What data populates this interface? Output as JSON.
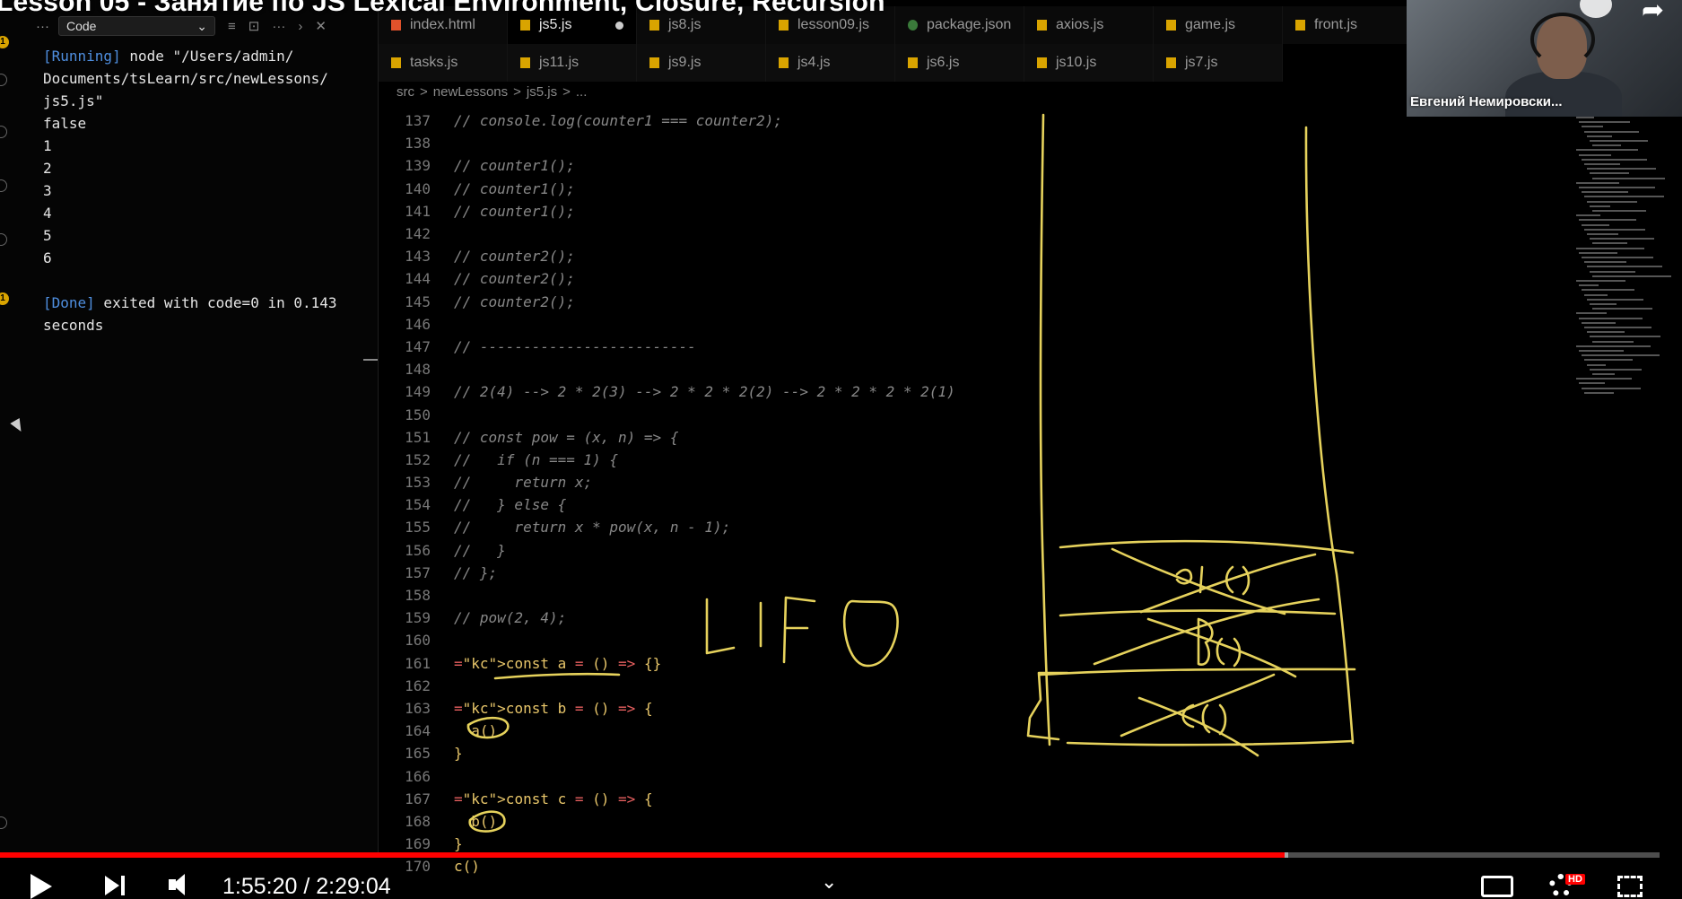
{
  "video": {
    "title": "Lesson 05 - Занятие по JS Lexical Environment, Closure, Recursion",
    "time_display": "1:55:20 / 2:29:04",
    "progress_fraction": 0.774,
    "buffered_fraction": 0.776,
    "hd_badge": "HD",
    "presenter_name": "Евгений Немировски..."
  },
  "output_panel": {
    "select_label": "Code",
    "lines": [
      {
        "prefix": "[Running]",
        "text": " node \"/Users/admin/"
      },
      {
        "prefix": "",
        "text": "Documents/tsLearn/src/newLessons/"
      },
      {
        "prefix": "",
        "text": "js5.js\""
      },
      {
        "prefix": "",
        "text": "false"
      },
      {
        "prefix": "",
        "text": "1"
      },
      {
        "prefix": "",
        "text": "2"
      },
      {
        "prefix": "",
        "text": "3"
      },
      {
        "prefix": "",
        "text": "4"
      },
      {
        "prefix": "",
        "text": "5"
      },
      {
        "prefix": "",
        "text": "6"
      },
      {
        "prefix": "",
        "text": ""
      },
      {
        "prefix": "[Done]",
        "text": " exited with code=0 in 0.143"
      },
      {
        "prefix": "",
        "text": "seconds"
      }
    ],
    "badge_count": "1"
  },
  "tabs_row1": [
    {
      "label": "index.html",
      "icon": "html-file-icon",
      "active": false
    },
    {
      "label": "js5.js",
      "icon": "js-file-icon",
      "active": true,
      "dirty": true
    },
    {
      "label": "js8.js",
      "icon": "js-file-icon",
      "active": false
    },
    {
      "label": "lesson09.js",
      "icon": "js-file-icon",
      "active": false
    },
    {
      "label": "package.json",
      "icon": "package-file-icon",
      "active": false
    },
    {
      "label": "axios.js",
      "icon": "js-file-icon",
      "active": false
    },
    {
      "label": "game.js",
      "icon": "js-file-icon",
      "active": false
    },
    {
      "label": "front.js",
      "icon": "js-file-icon",
      "active": false
    }
  ],
  "tabs_row2": [
    {
      "label": "tasks.js"
    },
    {
      "label": "js11.js"
    },
    {
      "label": "js9.js"
    },
    {
      "label": "js4.js"
    },
    {
      "label": "js6.js"
    },
    {
      "label": "js10.js"
    },
    {
      "label": "js7.js"
    }
  ],
  "breadcrumb": [
    "src",
    ">",
    "newLessons",
    ">",
    "js5.js",
    ">",
    "..."
  ],
  "code_lines": [
    {
      "n": "137",
      "t": "// console.log(counter1 === counter2);",
      "k": "c"
    },
    {
      "n": "138",
      "t": "",
      "k": "c"
    },
    {
      "n": "139",
      "t": "// counter1();",
      "k": "c"
    },
    {
      "n": "140",
      "t": "// counter1();",
      "k": "c"
    },
    {
      "n": "141",
      "t": "// counter1();",
      "k": "c"
    },
    {
      "n": "142",
      "t": "",
      "k": "c"
    },
    {
      "n": "143",
      "t": "// counter2();",
      "k": "c"
    },
    {
      "n": "144",
      "t": "// counter2();",
      "k": "c"
    },
    {
      "n": "145",
      "t": "// counter2();",
      "k": "c"
    },
    {
      "n": "146",
      "t": "",
      "k": "c"
    },
    {
      "n": "147",
      "t": "// -------------------------",
      "k": "c"
    },
    {
      "n": "148",
      "t": "",
      "k": "c"
    },
    {
      "n": "149",
      "t": "// 2(4) --> 2 * 2(3) --> 2 * 2 * 2(2) --> 2 * 2 * 2 * 2(1)",
      "k": "c"
    },
    {
      "n": "150",
      "t": "",
      "k": "c"
    },
    {
      "n": "151",
      "t": "// const pow = (x, n) => {",
      "k": "c"
    },
    {
      "n": "152",
      "t": "//   if (n === 1) {",
      "k": "c"
    },
    {
      "n": "153",
      "t": "//     return x;",
      "k": "c"
    },
    {
      "n": "154",
      "t": "//   } else {",
      "k": "c"
    },
    {
      "n": "155",
      "t": "//     return x * pow(x, n - 1);",
      "k": "c"
    },
    {
      "n": "156",
      "t": "//   }",
      "k": "c"
    },
    {
      "n": "157",
      "t": "// };",
      "k": "c"
    },
    {
      "n": "158",
      "t": "",
      "k": "c"
    },
    {
      "n": "159",
      "t": "// pow(2, 4);",
      "k": "c"
    },
    {
      "n": "160",
      "t": "",
      "k": "c"
    },
    {
      "n": "161",
      "t": "const a = () => {}",
      "k": "k"
    },
    {
      "n": "162",
      "t": "",
      "k": "k"
    },
    {
      "n": "163",
      "t": "const b = () => {",
      "k": "k"
    },
    {
      "n": "164",
      "t": "  a()",
      "k": "k"
    },
    {
      "n": "165",
      "t": "}",
      "k": "k"
    },
    {
      "n": "166",
      "t": "",
      "k": "k"
    },
    {
      "n": "167",
      "t": "const c = () => {",
      "k": "k"
    },
    {
      "n": "168",
      "t": "  b()",
      "k": "k"
    },
    {
      "n": "169",
      "t": "}",
      "k": "k"
    },
    {
      "n": "170",
      "t": "c()",
      "k": "k"
    }
  ],
  "drawing": {
    "handwritten_text": "LIFO",
    "stack_labels": [
      "a()",
      "b()",
      "c()"
    ],
    "color": "#e6d25c"
  },
  "colors": {
    "accent_progress": "#ff0000",
    "tab_active": "#000000",
    "comment": "#888888",
    "keyword": "#e8c66a"
  }
}
